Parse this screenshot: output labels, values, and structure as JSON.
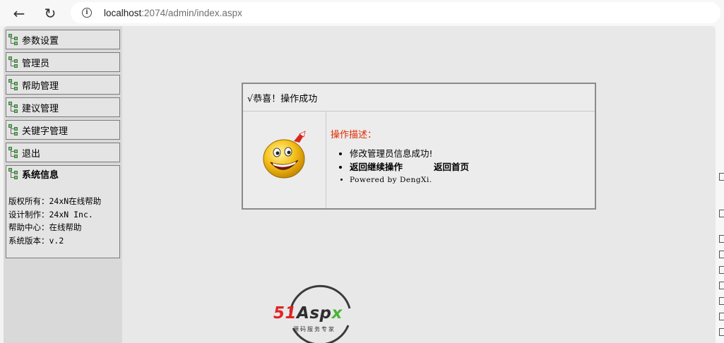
{
  "browser": {
    "url_host": "localhost",
    "url_path": ":2074/admin/index.aspx",
    "info_glyph": "i",
    "back_glyph": "←",
    "reload_glyph": "↻"
  },
  "sidebar": {
    "items": [
      {
        "label": "参数设置"
      },
      {
        "label": "管理员"
      },
      {
        "label": "帮助管理"
      },
      {
        "label": "建议管理"
      },
      {
        "label": "关键字管理"
      },
      {
        "label": "退出"
      }
    ],
    "sysinfo": {
      "title": "系统信息",
      "lines": [
        "版权所有：24xN在线帮助",
        "设计制作：24xN Inc.",
        "帮助中心：在线帮助",
        "系统版本：v.2"
      ]
    }
  },
  "message": {
    "header": "√恭喜！操作成功",
    "desc_title": "操作描述：",
    "detail": "修改管理员信息成功!",
    "link_continue": "返回继续操作",
    "link_home": "返回首页",
    "powered": "Powered by DengXi."
  },
  "logo": {
    "n51": "51",
    "aspx_a": "Asp",
    "aspx_x": "x",
    "subtitle": "源码服务专家"
  },
  "colors": {
    "desc_title": "#e02a00",
    "logo_red": "#e12323",
    "logo_green": "#4bb33a"
  }
}
